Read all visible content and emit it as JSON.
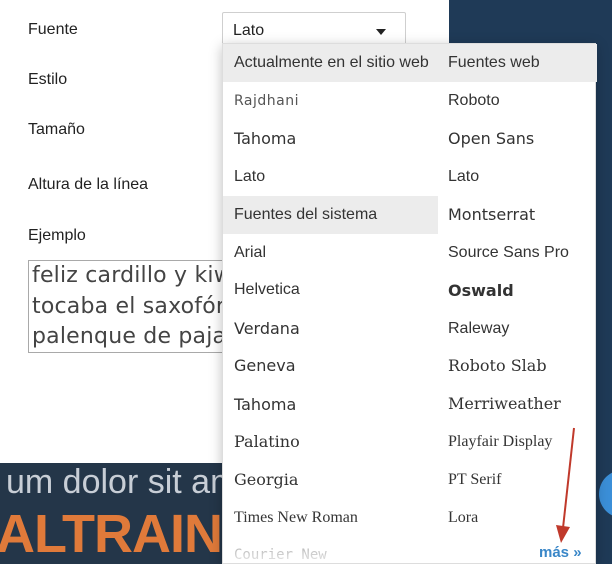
{
  "labels": {
    "font": "Fuente",
    "style": "Estilo",
    "size": "Tamaño",
    "line_height": "Altura de la línea",
    "example": "Ejemplo"
  },
  "font_select": {
    "value": "Lato"
  },
  "sample_text": [
    "feliz cardillo y kiwi. ",
    "tocaba el saxofón d",
    "palenque de paja."
  ],
  "banner": {
    "line1": "um dolor sit ame",
    "line2": "ALTRAININ"
  },
  "dropdown": {
    "left_column": [
      {
        "label": "Actualmente en el sitio web",
        "header": true
      },
      {
        "label": "Rajdhani"
      },
      {
        "label": "Tahoma"
      },
      {
        "label": "Lato"
      },
      {
        "label": "Fuentes del sistema",
        "header": true
      },
      {
        "label": "Arial"
      },
      {
        "label": "Helvetica"
      },
      {
        "label": "Verdana"
      },
      {
        "label": "Geneva"
      },
      {
        "label": "Tahoma"
      },
      {
        "label": "Palatino"
      },
      {
        "label": "Georgia"
      },
      {
        "label": "Times New Roman"
      },
      {
        "label": "Courier New"
      }
    ],
    "right_column": [
      {
        "label": "Fuentes web",
        "header": true
      },
      {
        "label": "Roboto"
      },
      {
        "label": "Open Sans"
      },
      {
        "label": "Lato"
      },
      {
        "label": "Montserrat"
      },
      {
        "label": "Source Sans Pro"
      },
      {
        "label": "Oswald"
      },
      {
        "label": "Raleway"
      },
      {
        "label": "Roboto Slab"
      },
      {
        "label": "Merriweather"
      },
      {
        "label": "Playfair Display"
      },
      {
        "label": "PT Serif"
      },
      {
        "label": "Lora"
      }
    ],
    "more_link": "más »"
  },
  "colors": {
    "header_bg": "#ececec",
    "link": "#3a87c8",
    "annotation_arrow": "#c0392b",
    "banner_accent": "#e07a3a"
  }
}
